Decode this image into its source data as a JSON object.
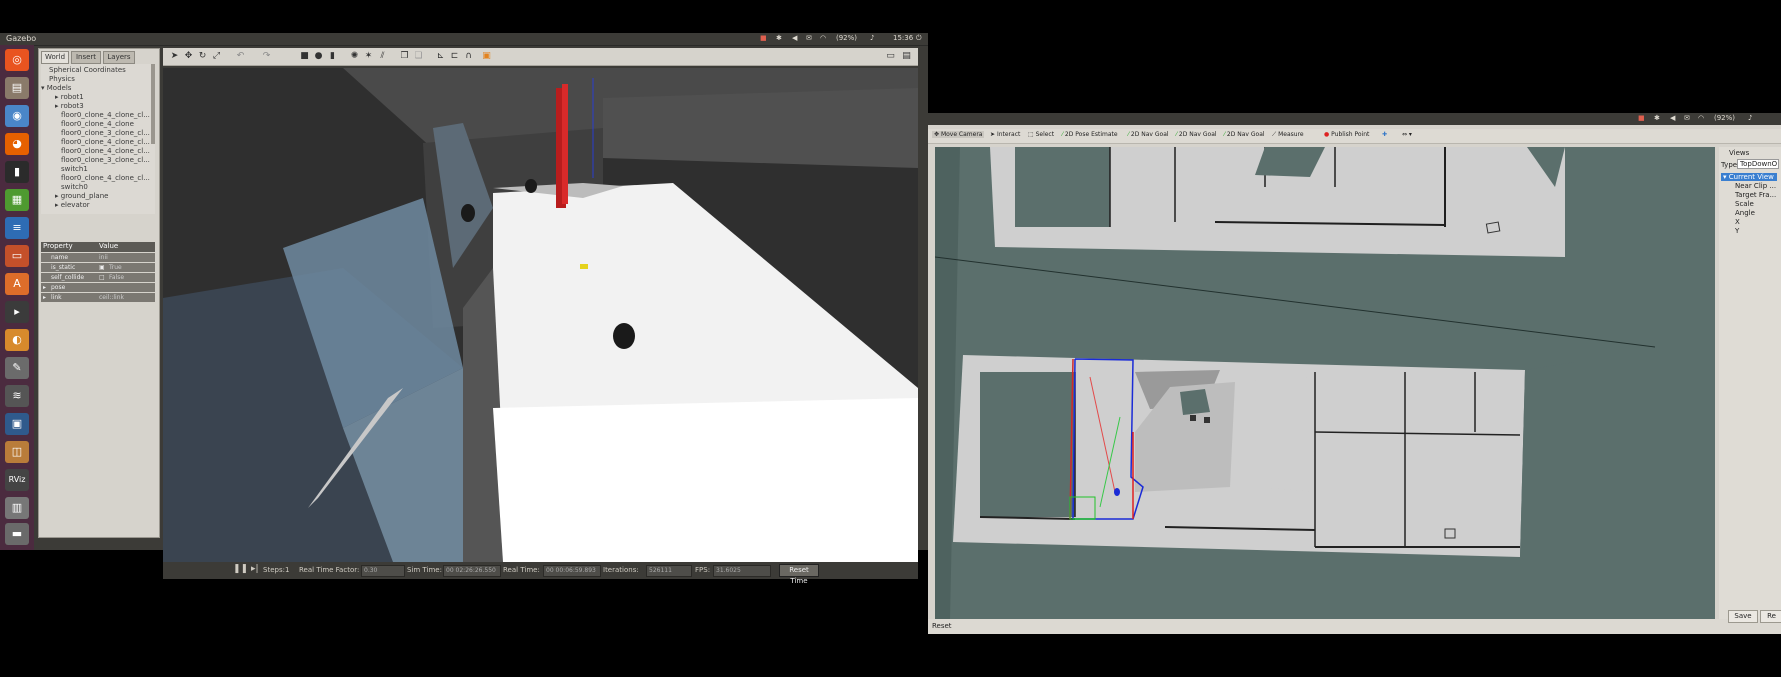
{
  "gazebo": {
    "title": "Gazebo",
    "tray": {
      "battery": "(92%)",
      "clock": "15:36"
    },
    "launcher_icons": [
      "ubuntu-dash-icon",
      "files-icon",
      "chromium-icon",
      "firefox-icon",
      "terminal-icon",
      "calc-icon",
      "writer-icon",
      "impress-icon",
      "software-center-icon",
      "video-icon",
      "blender-icon",
      "text-editor-icon",
      "network-icon",
      "screenshot-icon",
      "box-icon",
      "rviz-icon",
      "trash-icon",
      "drive-icon"
    ],
    "tabs": [
      "World",
      "Insert",
      "Layers"
    ],
    "tree": [
      "Spherical Coordinates",
      "Physics",
      "Models",
      "robot1",
      "robot3",
      "floor0_clone_4_clone_cl...",
      "floor0_clone_4_clone",
      "floor0_clone_3_clone_cl...",
      "floor0_clone_4_clone_cl...",
      "floor0_clone_4_clone_cl...",
      "floor0_clone_3_clone_cl...",
      "switch1",
      "floor0_clone_4_clone_cl...",
      "switch0",
      "ground_plane",
      "elevator"
    ],
    "properties": {
      "header": [
        "Property",
        "Value"
      ],
      "rows": [
        {
          "name": "name",
          "value": "inii"
        },
        {
          "name": "is_static",
          "value": "True"
        },
        {
          "name": "self_collide",
          "value": "False"
        },
        {
          "name": "pose",
          "value": ""
        },
        {
          "name": "link",
          "value": "ceil::link"
        }
      ]
    },
    "status": {
      "steps_label": "Steps:",
      "steps_value": "1",
      "rtf_label": "Real Time Factor:",
      "rtf_value": "0.30",
      "sim_time_label": "Sim Time:",
      "sim_time_value": "00 02:26:26.550",
      "real_time_label": "Real Time:",
      "real_time_value": "00 00:06:59.893",
      "iterations_label": "Iterations:",
      "iterations_value": "526111",
      "fps_label": "FPS:",
      "fps_value": "31.6025",
      "reset_label": "Reset Time"
    }
  },
  "rviz": {
    "tray": {
      "battery": "(92%)"
    },
    "toolbar": [
      "Move Camera",
      "Interact",
      "Select",
      "2D Pose Estimate",
      "2D Nav Goal",
      "2D Nav Goal",
      "2D Nav Goal",
      "Measure",
      "Publish Point"
    ],
    "views": {
      "title": "Views",
      "type_label": "Type:",
      "type_value": "TopDownO",
      "current_view": "Current View",
      "items": [
        "Near Clip ...",
        "Target Fra...",
        "Scale",
        "Angle",
        "X",
        "Y"
      ],
      "save_label": "Save",
      "remove_label": "Re"
    },
    "reset_label": "Reset"
  }
}
